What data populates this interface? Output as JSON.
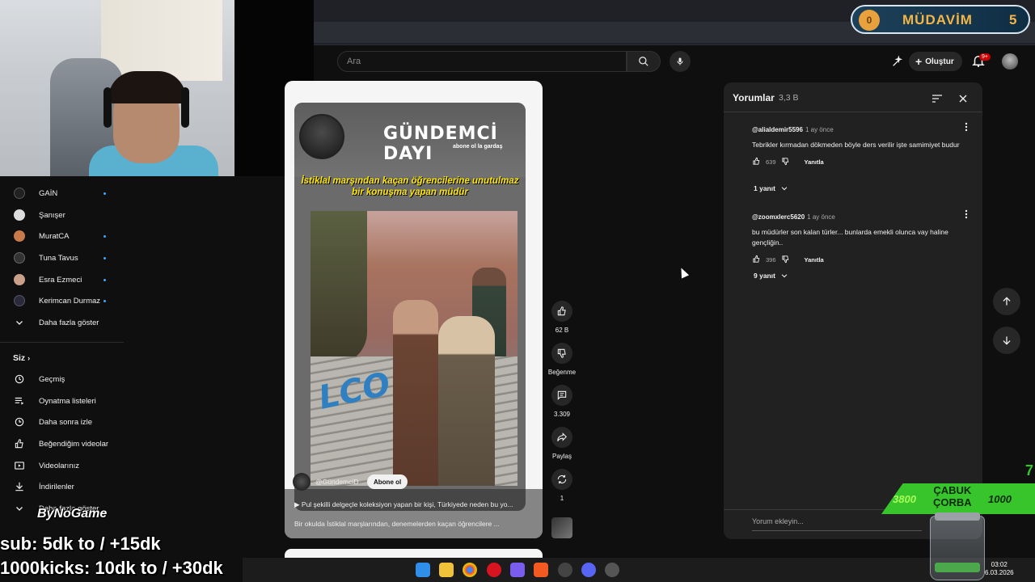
{
  "header": {
    "search_placeholder": "Ara",
    "create_label": "Oluştur",
    "notif_badge": "9+"
  },
  "sidebar": {
    "subscriptions": [
      {
        "label": "GAİN",
        "avatar_color": "#222222",
        "new": true
      },
      {
        "label": "Şanışer",
        "avatar_color": "#dddddd",
        "new": false
      },
      {
        "label": "MuratCA",
        "avatar_color": "#c97a4a",
        "new": true
      },
      {
        "label": "Tuna Tavus",
        "avatar_color": "#333333",
        "new": true
      },
      {
        "label": "Esra Ezmeci",
        "avatar_color": "#c9a08a",
        "new": true
      },
      {
        "label": "Kerimcan Durmaz",
        "avatar_color": "#2a2a3a",
        "new": true
      }
    ],
    "show_more_label": "Daha fazla göster",
    "you_section": "Siz",
    "you_items": [
      {
        "label": "Geçmiş",
        "icon": "history-icon"
      },
      {
        "label": "Oynatma listeleri",
        "icon": "playlist-icon"
      },
      {
        "label": "Daha sonra izle",
        "icon": "watch-later-icon"
      },
      {
        "label": "Beğendiğim videolar",
        "icon": "liked-icon"
      },
      {
        "label": "Videolarınız",
        "icon": "your-videos-icon"
      },
      {
        "label": "İndirilenler",
        "icon": "download-icon"
      },
      {
        "label": "Daha fazla göster",
        "icon": "chevron-down-icon"
      }
    ]
  },
  "short": {
    "brand_title": "GÜNDEMCİ DAYI",
    "brand_sub": "abone ol la gardaş",
    "headline": "İstiklal marşından kaçan öğrencilerine unutulmaz bir konuşma yapan müdür",
    "video_logo_text": "LCO",
    "channel": "@GündemciD",
    "subscribe_label": "Abone ol",
    "song_line": "Pul şekilli delgeçle koleksiyon yapan bir kişi, Türkiyede neden bu yo...",
    "description": "Bir okulda İstiklal marşlarından, denemelerden kaçan öğrencilere ..."
  },
  "actions": {
    "likes": "62 B",
    "dislike_label": "Beğenme",
    "comments": "3.309",
    "share_label": "Paylaş",
    "remix_count": "1"
  },
  "comments_panel": {
    "title": "Yorumlar",
    "count": "3,3 B",
    "comments": [
      {
        "user": "@alialdemir5596",
        "time": "1 ay önce",
        "text": "Tebrikler kırmadan dökmeden böyle ders verilir işte samimiyet budur",
        "likes": "639",
        "reply_label": "Yanıtla",
        "replies": "1 yanıt"
      },
      {
        "user": "@zoomxlerc5620",
        "time": "1 ay önce",
        "text": "bu müdürler son kalan türler... bunlarda emekli olunca vay haline gençliğin..",
        "likes": "396",
        "reply_label": "Yanıtla",
        "replies": "9 yanıt"
      }
    ],
    "input_placeholder": "Yorum ekleyin..."
  },
  "overlays": {
    "mudavim_icon": "0",
    "mudavim_label": "MÜDAVİM",
    "mudavim_count": "5",
    "cabuk_left": "3800",
    "cabuk_title_1": "ÇABUK",
    "cabuk_title_2": "ÇORBA",
    "cabuk_right": "1000",
    "cabuk_seven": "7",
    "bynogame": "ByNoGame",
    "sub_line": "sub: 5dk to / +15dk",
    "kicks_line": "1000kicks: 10dk to / +30dk"
  },
  "taskbar": {
    "time": "03:02",
    "date": "6.03.2026"
  },
  "colors": {
    "accent_blue": "#3ea6ff",
    "youtube_red": "#cc0000",
    "headline_yellow": "#ffe800",
    "cabuk_green": "#37c52b",
    "mudavim_gold": "#f3b548"
  }
}
